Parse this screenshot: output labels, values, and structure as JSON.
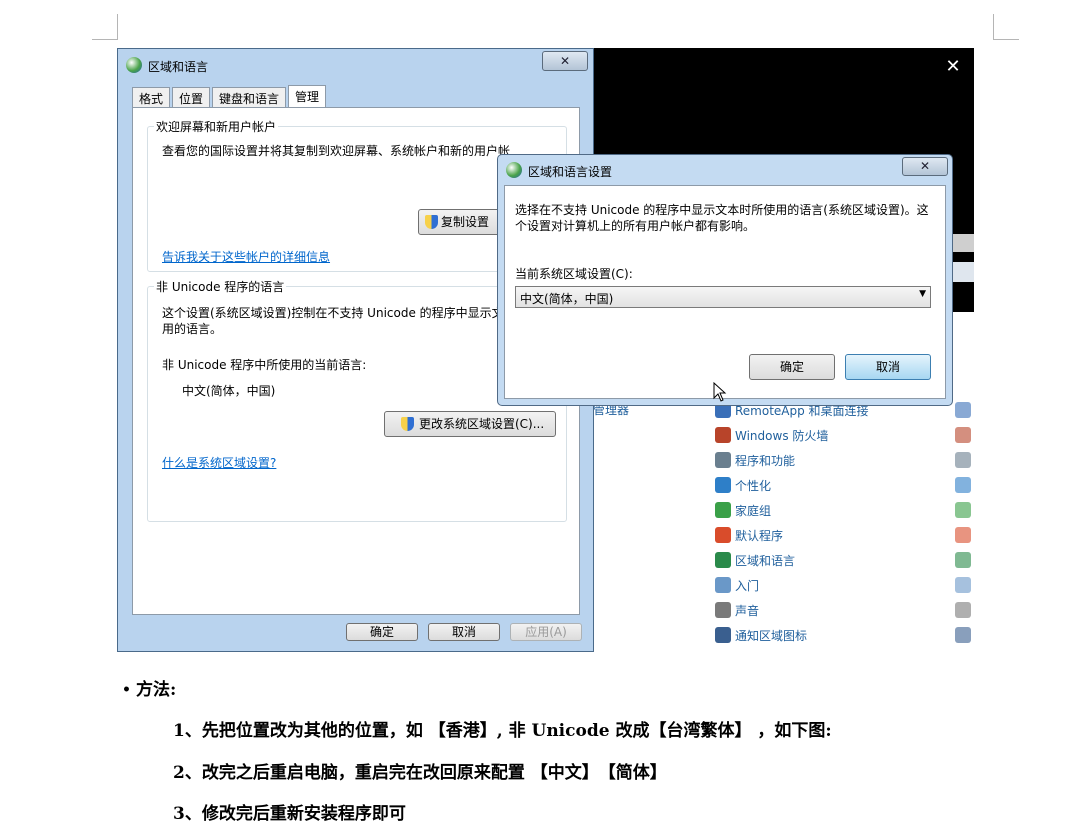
{
  "main_window": {
    "title": "区域和语言",
    "close": "✕",
    "tabs": [
      "格式",
      "位置",
      "键盘和语言",
      "管理"
    ],
    "welcome_group": {
      "label": "欢迎屏幕和新用户帐户",
      "text": "查看您的国际设置并将其复制到欢迎屏幕、系统帐户和新的用户帐",
      "copy_button": "复制设置",
      "link": "告诉我关于这些帐户的详细信息"
    },
    "unicode_group": {
      "label": "非 Unicode 程序的语言",
      "text_line1": "这个设置(系统区域设置)控制在不支持 Unicode 的程序中显示文",
      "text_line2": "用的语言。",
      "current_label": "非 Unicode 程序中所使用的当前语言:",
      "current_value": "中文(简体，中国)",
      "change_button": "更改系统区域设置(C)...",
      "link": "什么是系统区域设置?"
    },
    "ok": "确定",
    "cancel": "取消",
    "apply": "应用(A)"
  },
  "dialog": {
    "title": "区域和语言设置",
    "close": "✕",
    "desc_line1": "选择在不支持 Unicode 的程序中显示文本时所使用的语言(系统区域设置)。这",
    "desc_line2": "个设置对计算机上的所有用户帐户都有影响。",
    "current_label": "当前系统区域设置(C):",
    "selected": "中文(简体，中国)",
    "ok": "确定",
    "cancel": "取消"
  },
  "control_panel": {
    "close": "✕",
    "left_partial": "管理器",
    "items": [
      {
        "label": "RemoteApp 和桌面连接",
        "icon": "remote-desktop-icon",
        "color": "#3a6fb8"
      },
      {
        "label": "Windows 防火墙",
        "icon": "firewall-icon",
        "color": "#b8442a"
      },
      {
        "label": "程序和功能",
        "icon": "programs-icon",
        "color": "#6a7f8f"
      },
      {
        "label": "个性化",
        "icon": "personalize-icon",
        "color": "#2e7fc8"
      },
      {
        "label": "家庭组",
        "icon": "homegroup-icon",
        "color": "#3aa048"
      },
      {
        "label": "默认程序",
        "icon": "default-programs-icon",
        "color": "#d94c2b"
      },
      {
        "label": "区域和语言",
        "icon": "region-language-icon",
        "color": "#2a8a4a"
      },
      {
        "label": "入门",
        "icon": "getting-started-icon",
        "color": "#6a98c8"
      },
      {
        "label": "声音",
        "icon": "sound-icon",
        "color": "#7a7a7a"
      },
      {
        "label": "通知区域图标",
        "icon": "notification-icon",
        "color": "#3a5f8f"
      }
    ]
  },
  "document": {
    "bullet": "•",
    "heading": "方法:",
    "steps": [
      "1、先把位置改为其他的位置，如 【香港】, 非 Unicode 改成【台湾繁体】 ，如下图:",
      "2、改完之后重启电脑，重启完在改回原来配置 【中文】　【简体】",
      "3、修改完后重新安装程序即可"
    ]
  }
}
